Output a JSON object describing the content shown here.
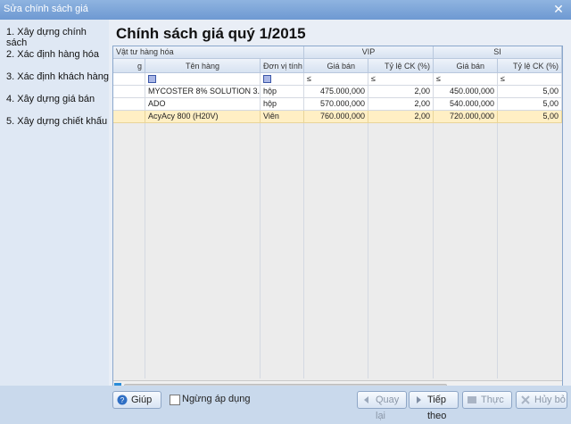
{
  "window": {
    "title": "Sửa chính sách giá"
  },
  "sidebar": {
    "steps": [
      {
        "label": "1. Xây dựng chính sách"
      },
      {
        "label": "2. Xác định hàng hóa"
      },
      {
        "label": "3. Xác định khách hàng"
      },
      {
        "label": "4. Xây dựng giá bán"
      },
      {
        "label": "5. Xây dựng chiết khấu"
      }
    ]
  },
  "main": {
    "heading": "Chính sách giá quý 1/2015",
    "grid": {
      "band_goods": "Vật tư hàng hóa",
      "band_vip": "VIP",
      "band_si": "SI",
      "columns": {
        "code": "g",
        "name": "Tên hàng",
        "unit": "Đơn vị tính",
        "vip_price": "Giá bán",
        "vip_discount": "Tỷ lệ CK (%)",
        "si_price": "Giá bán",
        "si_discount": "Tỷ lệ CK (%)"
      },
      "filter_symbol": "≤",
      "rows": [
        {
          "name": "MYCOSTER 8% SOLUTION 3...",
          "unit": "hộp",
          "vip_price": "475.000,000",
          "vip_discount": "2,00",
          "si_price": "450.000,000",
          "si_discount": "5,00"
        },
        {
          "name": "ADO",
          "unit": "hộp",
          "vip_price": "570.000,000",
          "vip_discount": "2,00",
          "si_price": "540.000,000",
          "si_discount": "5,00"
        },
        {
          "name": "AcyAcy 800 (H20V)",
          "unit": "Viên",
          "vip_price": "760.000,000",
          "vip_discount": "2,00",
          "si_price": "720.000,000",
          "si_discount": "5,00"
        }
      ]
    }
  },
  "footer": {
    "help_label": "Giúp",
    "discontinue_label": "Ngừng áp dụng",
    "back_label": "Quay lại",
    "next_label": "Tiếp theo",
    "finish_label": "Thực hiện",
    "cancel_label": "Hủy bỏ"
  },
  "colors": {
    "selected_row": "#ffefc4",
    "titlebar": "#7aa3d8"
  }
}
